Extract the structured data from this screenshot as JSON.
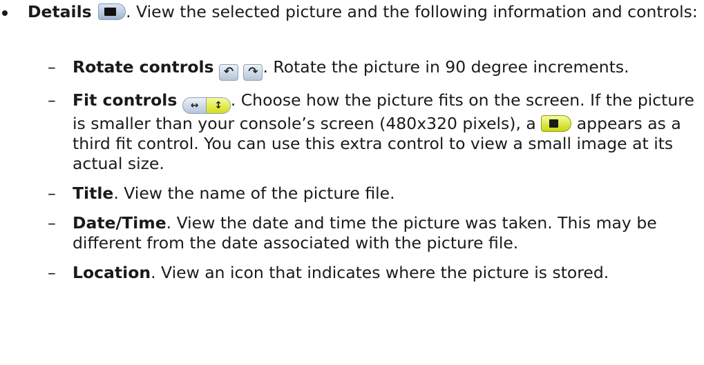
{
  "details": {
    "title": "Details",
    "text": ". View the selected picture and the following information and controls:"
  },
  "items": [
    {
      "title": "Rotate controls",
      "text": ". Rotate the picture in 90 degree increments."
    },
    {
      "title": "Fit controls",
      "text_a": ". Choose how the picture fits on the screen. If the picture is smaller than your console’s screen (480x320 pixels), a",
      "text_b": " appears as a third fit control. You can use this extra control to view a small image at its actual size."
    },
    {
      "title": "Title",
      "text": ". View the name of the picture file."
    },
    {
      "title": "Date/Time",
      "text": ". View the date and time the picture was taken. This may be different from the date associated with the picture file."
    },
    {
      "title": "Location",
      "text": ". View an icon that indicates where the picture is stored."
    }
  ],
  "icons": {
    "details": "details-view-icon",
    "rotate_left": "rotate-left-icon",
    "rotate_right": "rotate-right-icon",
    "fit_width": "fit-width-icon",
    "fit_height": "fit-height-icon",
    "actual_size": "actual-size-icon"
  },
  "dash": "–"
}
